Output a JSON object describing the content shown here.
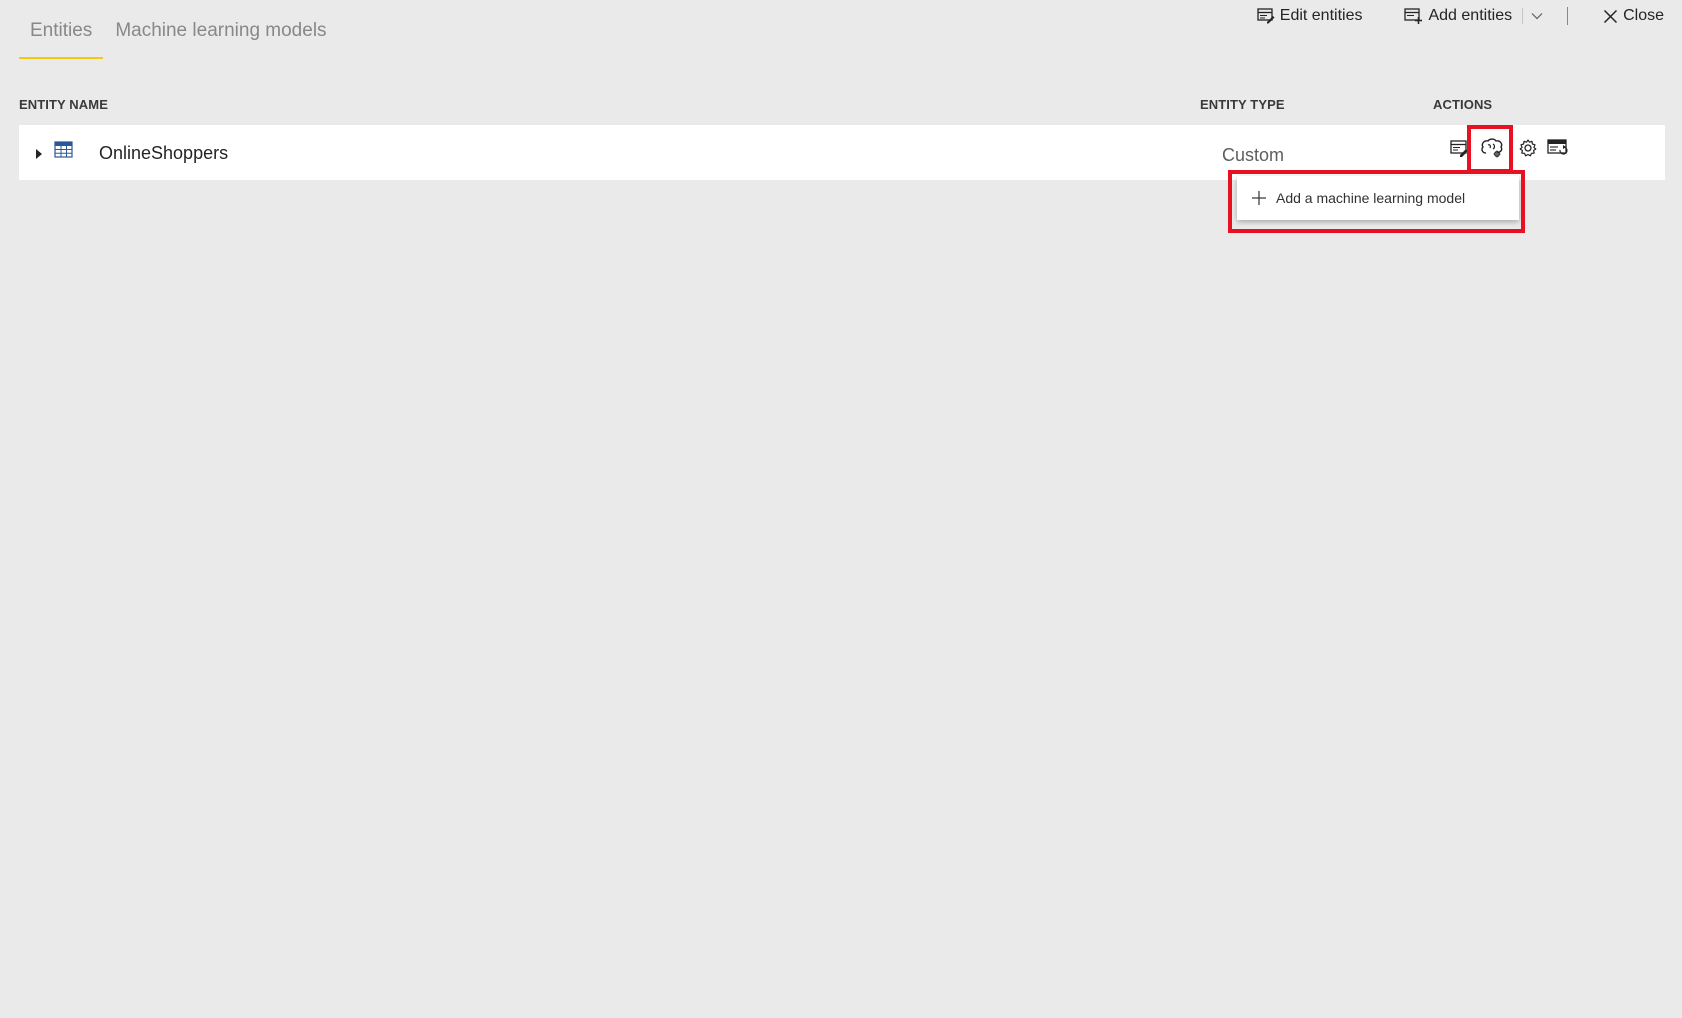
{
  "tabs": [
    {
      "label": "Entities",
      "active": true
    },
    {
      "label": "Machine learning models",
      "active": false
    }
  ],
  "toolbar": {
    "edit_entities": "Edit entities",
    "add_entities": "Add entities",
    "close": "Close"
  },
  "columns": {
    "name": "ENTITY NAME",
    "type": "ENTITY TYPE",
    "actions": "ACTIONS"
  },
  "rows": [
    {
      "name": "OnlineShoppers",
      "type": "Custom"
    }
  ],
  "menu": {
    "add_ml_model": "Add a machine learning model"
  },
  "colors": {
    "background": "#eaeaea",
    "tab_underline": "#f2c811",
    "highlight": "#e81123"
  },
  "icons": [
    "edit-entities-icon",
    "add-entities-icon",
    "chevron-down-icon",
    "close-icon",
    "expand-caret-icon",
    "table-icon",
    "edit-entity-icon",
    "ai-insights-icon",
    "settings-icon",
    "incremental-refresh-icon",
    "plus-icon"
  ]
}
